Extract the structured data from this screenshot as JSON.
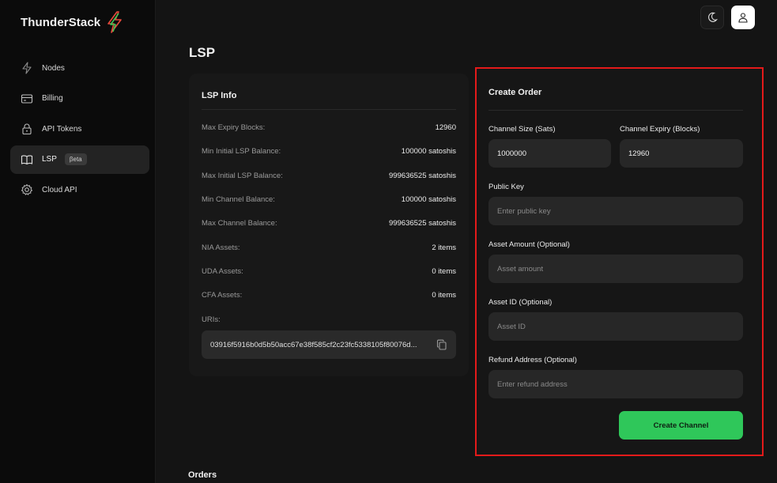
{
  "brand": {
    "name": "ThunderStack"
  },
  "sidebar": {
    "items": [
      {
        "label": "Nodes",
        "icon": "bolt-icon"
      },
      {
        "label": "Billing",
        "icon": "card-icon"
      },
      {
        "label": "API Tokens",
        "icon": "lock-icon"
      },
      {
        "label": "LSP",
        "icon": "book-icon",
        "badge": "βeta",
        "active": true
      },
      {
        "label": "Cloud API",
        "icon": "gear-icon"
      }
    ]
  },
  "page": {
    "title": "LSP"
  },
  "lsp_info": {
    "title": "LSP Info",
    "rows": [
      {
        "label": "Max Expiry Blocks:",
        "value": "12960"
      },
      {
        "label": "Min Initial LSP Balance:",
        "value": "100000 satoshis"
      },
      {
        "label": "Max Initial LSP Balance:",
        "value": "999636525 satoshis"
      },
      {
        "label": "Min Channel Balance:",
        "value": "100000 satoshis"
      },
      {
        "label": "Max Channel Balance:",
        "value": "999636525 satoshis"
      },
      {
        "label": "NIA Assets:",
        "value": "2 items"
      },
      {
        "label": "UDA Assets:",
        "value": "0 items"
      },
      {
        "label": "CFA Assets:",
        "value": "0 items"
      }
    ],
    "uris_label": "URIs:",
    "uri": "03916f5916b0d5b50acc67e38f585cf2c23fc5338105f80076d..."
  },
  "create_order": {
    "title": "Create Order",
    "channel_size": {
      "label": "Channel Size (Sats)",
      "value": "1000000"
    },
    "channel_expiry": {
      "label": "Channel Expiry (Blocks)",
      "value": "12960"
    },
    "public_key": {
      "label": "Public Key",
      "placeholder": "Enter public key"
    },
    "asset_amount": {
      "label": "Asset Amount (Optional)",
      "placeholder": "Asset amount"
    },
    "asset_id": {
      "label": "Asset ID (Optional)",
      "placeholder": "Asset ID"
    },
    "refund_address": {
      "label": "Refund Address (Optional)",
      "placeholder": "Enter refund address"
    },
    "submit_label": "Create Channel"
  },
  "orders": {
    "title": "Orders"
  },
  "colors": {
    "accent": "#2fc75a",
    "highlight": "#e41a1a",
    "bolt_red": "#e84a3c",
    "bolt_green": "#3fc455"
  }
}
